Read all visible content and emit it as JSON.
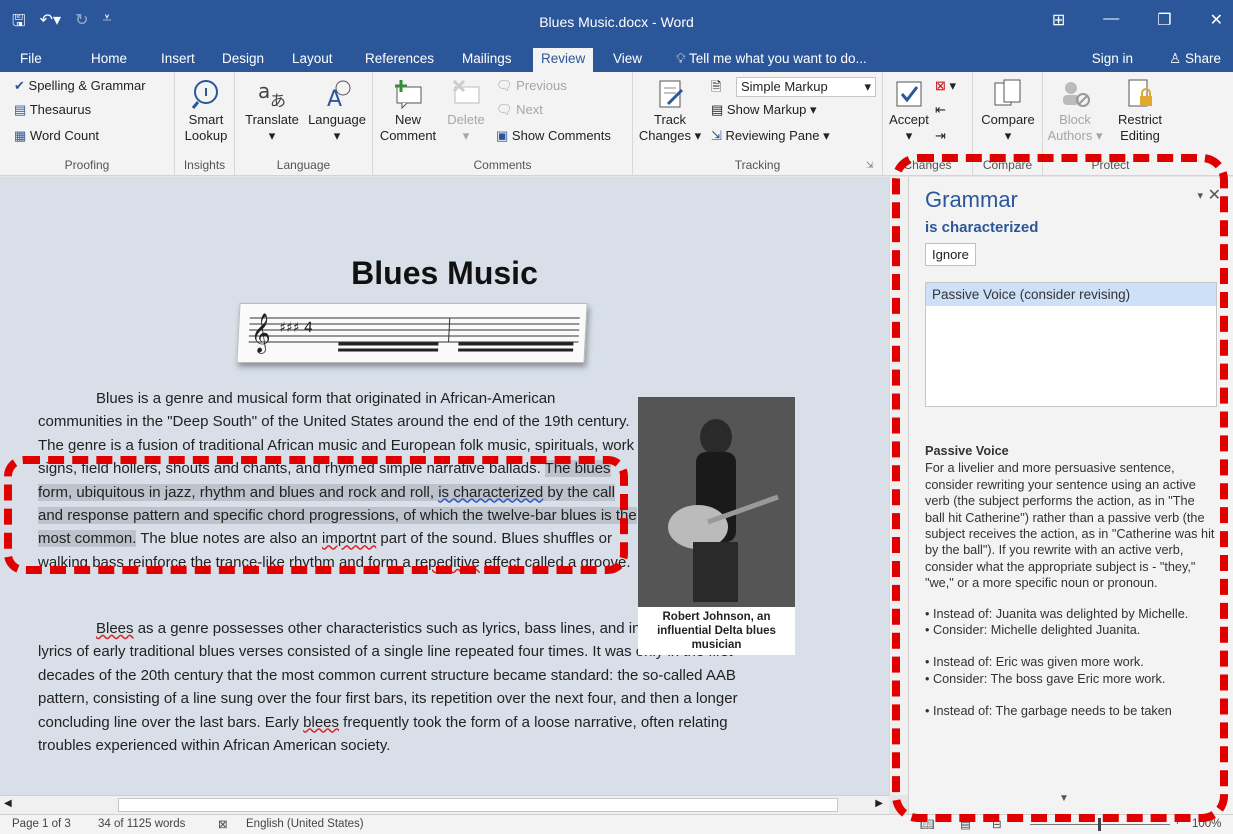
{
  "window": {
    "title": "Blues Music.docx - Word"
  },
  "tabs": [
    "File",
    "Home",
    "Insert",
    "Design",
    "Layout",
    "References",
    "Mailings",
    "Review",
    "View"
  ],
  "tell_me": "Tell me what you want to do...",
  "sign_in": "Sign in",
  "share": "Share",
  "ribbon": {
    "proofing": {
      "spelling": "Spelling & Grammar",
      "thesaurus": "Thesaurus",
      "word_count": "Word Count",
      "label": "Proofing"
    },
    "insights": {
      "smart_lookup_1": "Smart",
      "smart_lookup_2": "Lookup",
      "label": "Insights"
    },
    "language": {
      "translate": "Translate",
      "language": "Language",
      "label": "Language"
    },
    "comments": {
      "new_1": "New",
      "new_2": "Comment",
      "delete": "Delete",
      "previous": "Previous",
      "next": "Next",
      "show": "Show Comments",
      "label": "Comments"
    },
    "tracking": {
      "track_1": "Track",
      "track_2": "Changes",
      "markup_select": "Simple Markup",
      "show_markup": "Show Markup",
      "reviewing_pane": "Reviewing Pane",
      "label": "Tracking"
    },
    "changes": {
      "accept": "Accept",
      "label": "Changes"
    },
    "compare": {
      "compare": "Compare",
      "label": "Compare"
    },
    "protect": {
      "block_1": "Block",
      "block_2": "Authors",
      "restrict_1": "Restrict",
      "restrict_2": "Editing",
      "label": "Protect"
    }
  },
  "document": {
    "title": "Blues Music",
    "p1_a": "Blues is a genre and musical form that originated in African-American communities in the \"Deep South\" of the United States around the end of the 19th century. The genre is a fusion of traditional African music and European folk music, spirituals, work signs, field hollers, shouts and chants, and rhymed simple narrative ballads. ",
    "p1_hl1": "The blues form, ubiquitous in jazz, rhythm and blues and rock and roll, ",
    "p1_hl_word": "is characterized",
    "p1_hl2": " by the call and response pattern and specific chord progressions, of which the twelve-bar blues is the most common.",
    "p1_b": " The blue notes are also an ",
    "p1_typo1": "importnt",
    "p1_c": " part of the sound. Blues shuffles or walking bass reinforce the trance-like rhythm and form a ",
    "p1_typo2": "repeditive",
    "p1_d": " effect called a groove.",
    "p2_typo1": "Blees",
    "p2_a": " as a genre possesses other characteristics such as lyrics, bass lines, and instruments. The lyrics of early traditional blues verses consisted of a single line repeated four times. It was only in the first decades of the 20th century that the most common current structure became standard: the so-called AAB pattern, consisting of a line sung over the four first bars, its repetition over the next four, and then a longer concluding line over the last bars. Early ",
    "p2_typo2": "blees",
    "p2_b": " frequently took the form of a loose narrative, often relating troubles experienced within African American society.",
    "caption": "Robert Johnson, an influential Delta blues musician"
  },
  "grammar_pane": {
    "title": "Grammar",
    "word": "is characterized",
    "ignore": "Ignore",
    "suggestion": "Passive Voice (consider revising)",
    "heading": "Passive Voice",
    "body": "For a livelier and more persuasive sentence, consider rewriting your sentence using an active verb (the subject performs the action, as in \"The ball hit Catherine\") rather than a passive verb (the subject receives the action, as in \"Catherine was hit by the ball\").  If you rewrite with an active verb, consider what the appropriate subject is - \"they,\" \"we,\" or a more specific noun or pronoun.",
    "ex1a": "• Instead of: Juanita was delighted by Michelle.",
    "ex1b": "• Consider: Michelle delighted Juanita.",
    "ex2a": "• Instead of: Eric was given more work.",
    "ex2b": "• Consider: The boss gave Eric more work.",
    "ex3a": "• Instead of: The garbage needs to be taken"
  },
  "status": {
    "page": "Page 1 of 3",
    "words": "34 of 1125 words",
    "language": "English (United States)",
    "zoom": "100%"
  },
  "colors": {
    "accent": "#2b579a",
    "highlight_dash": "#e00000"
  }
}
